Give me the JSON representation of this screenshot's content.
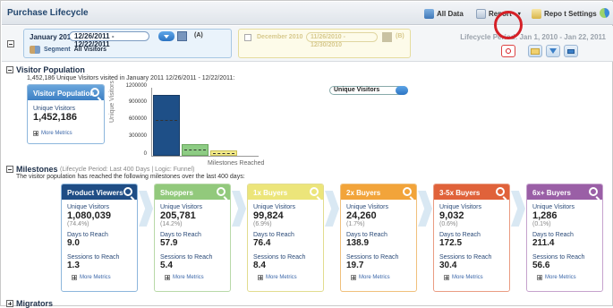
{
  "titlebar": {
    "title": "Purchase Lifecycle",
    "all_data_label": "All Data",
    "report_label": "Report",
    "report_settings_label": "Repo t Settings"
  },
  "segment": {
    "month": "January 2011",
    "date_range": "12/26/2011 - 12/22/2011",
    "marker": "(A)",
    "segment_label": "Segment",
    "segment_value": "All Visitors"
  },
  "compare": {
    "month": "December 2010",
    "date_range": "11/26/2010 - 12/30/2010",
    "marker": "(B)"
  },
  "lifecycle_period": "Lifecycle Period: Jan 1, 2010 - Jan 22, 2011",
  "visitor_population": {
    "heading": "Visitor Population",
    "subtitle": "1,452,186 Unique Visitors visited in January 2011 12/26/2011 - 12/22/2011:",
    "card_title": "Visitor Population",
    "uv_label": "Unique Visitors",
    "uv_value": "1,452,186",
    "more_metrics": "More Metrics",
    "metric_select": "Unique Visitors"
  },
  "chart_data": {
    "type": "bar",
    "ylabel": "Unique Visitors",
    "xlabel": "Milestones Reached",
    "yticks": [
      "1200000",
      "900000",
      "600000",
      "300000",
      "0"
    ],
    "ylim": [
      0,
      1200000
    ],
    "values": [
      1080039,
      205781,
      99824
    ],
    "colors": [
      "#1e4f87",
      "#8dcc84",
      "#f3ea8a"
    ]
  },
  "milestones": {
    "heading": "Milestones",
    "period_note": "(Lifecycle Period: Last 400 Days | Logic: Funnel)",
    "subtitle": "The visitor population has reached the following milestones over the last 400 days:",
    "uv_label": "Unique Visitors",
    "days_label": "Days to Reach",
    "sessions_label": "Sessions to Reach",
    "more_metrics": "More Metrics",
    "cards": [
      {
        "title": "Product Viewers",
        "uv": "1,080,039",
        "pct": "(74.4%)",
        "days": "9.0",
        "sessions": "1.3",
        "color": "#1f4d85",
        "border": "#8db6dc"
      },
      {
        "title": "Shoppers",
        "uv": "205,781",
        "pct": "(14.2%)",
        "days": "57.9",
        "sessions": "5.4",
        "color": "#92c97c",
        "border": "#b8d9a8"
      },
      {
        "title": "1x Buyers",
        "uv": "99,824",
        "pct": "(6.9%)",
        "days": "76.4",
        "sessions": "8.4",
        "color": "#ece57a",
        "border": "#e2dc8f"
      },
      {
        "title": "2x Buyers",
        "uv": "24,260",
        "pct": "(1.7%)",
        "days": "138.9",
        "sessions": "19.7",
        "color": "#f2a43a",
        "border": "#f0c07c"
      },
      {
        "title": "3-5x Buyers",
        "uv": "9,032",
        "pct": "(0.6%)",
        "days": "172.5",
        "sessions": "30.4",
        "color": "#e0623a",
        "border": "#ea9c82"
      },
      {
        "title": "6x+ Buyers",
        "uv": "1,286",
        "pct": "(0.1%)",
        "days": "211.4",
        "sessions": "56.6",
        "color": "#9a5fa6",
        "border": "#c6a2cd"
      }
    ]
  },
  "migrators": {
    "heading": "Migrators"
  }
}
